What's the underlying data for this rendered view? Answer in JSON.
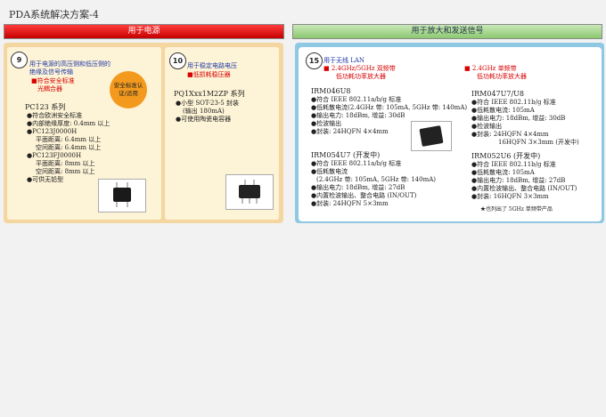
{
  "page_title": "PDA系统解决方案-4",
  "sections": {
    "power_header": "用于电源",
    "amp_header": "用于放大和发送信号"
  },
  "card9": {
    "number": "9",
    "heading_1": "用于电源的高压侧和低压侧的",
    "heading_2": "绝缘及信号传输",
    "sub_1": "■符合安全标准",
    "sub_2": "光耦合器",
    "badge": "安全标准认证/适用",
    "series": "PC123 系列",
    "lines": [
      "●符合欧洲安全标准",
      "●内部绝缘厚度: 0.4mm 以上",
      "●PC123J0000H",
      "平面距离: 6.4mm 以上",
      "空间距离: 6.4mm 以上",
      "●PC123FJ0000H",
      "平面距离: 8mm 以上",
      "空间距离: 8mm 以上",
      "●可供无铅型"
    ]
  },
  "card10": {
    "number": "10",
    "heading": "用于稳定电路电压",
    "sub": "■低损耗稳压器",
    "series": "PQ1Xxx1M2ZP 系列",
    "lines": [
      "●小型 SOT-23-5 封装",
      "(输出 180mA)",
      "●可使用陶瓷电容器"
    ]
  },
  "card15": {
    "number": "15",
    "heading": "用于无线 LAN",
    "left_sub_1": "■ 2.4GHz/5GHz 双频带",
    "left_sub_2": "低功耗功率放大器",
    "right_sub_1": "■ 2.4GHz 单频带",
    "right_sub_2": "低功耗功率放大器",
    "irm046u8": {
      "name": "IRM046U8",
      "lines": [
        "●符合 IEEE 802.11a/b/g 标准",
        "●低耗散电流(2.4GHz 带: 105mA, 5GHz 带: 140mA)",
        "●输出电力: 18dBm, 增益: 30dB",
        "●检波输出",
        "●封装: 24HQFN 4×4mm"
      ]
    },
    "irm054u7": {
      "name": "IRM054U7 (开发中)",
      "lines": [
        "●符合 IEEE 802.11a/b/g 标准",
        "●低耗散电流",
        "(2.4GHz 带: 105mA, 5GHz 带: 140mA)",
        "●输出电力: 18dBm, 增益: 27dB",
        "●内置检波输出、整合电路 (IN/OUT)",
        "●封装: 24HQFN 5×3mm"
      ]
    },
    "irm047u7": {
      "name": "IRM047U7/U8",
      "lines": [
        "●符合 IEEE 802.11b/g 标准",
        "●低耗散电流: 105mA",
        "●输出电力: 18dBm, 增益: 30dB",
        "●检波输出",
        "●封装: 24HQFN 4×4mm",
        "16HQFN 3×3mm (开发中)"
      ]
    },
    "irm052u6": {
      "name": "IRM052U6 (开发中)",
      "lines": [
        "●符合 IEEE 802.11b/g 标准",
        "●低耗散电流: 105mA",
        "●输出电力: 18dBm, 增益: 27dB",
        "●内置检波输出、整合电路 (IN/OUT)",
        "●封装: 16HQFN 3×3mm"
      ]
    },
    "note": "★也列出了 5GHz 单频带产品"
  }
}
